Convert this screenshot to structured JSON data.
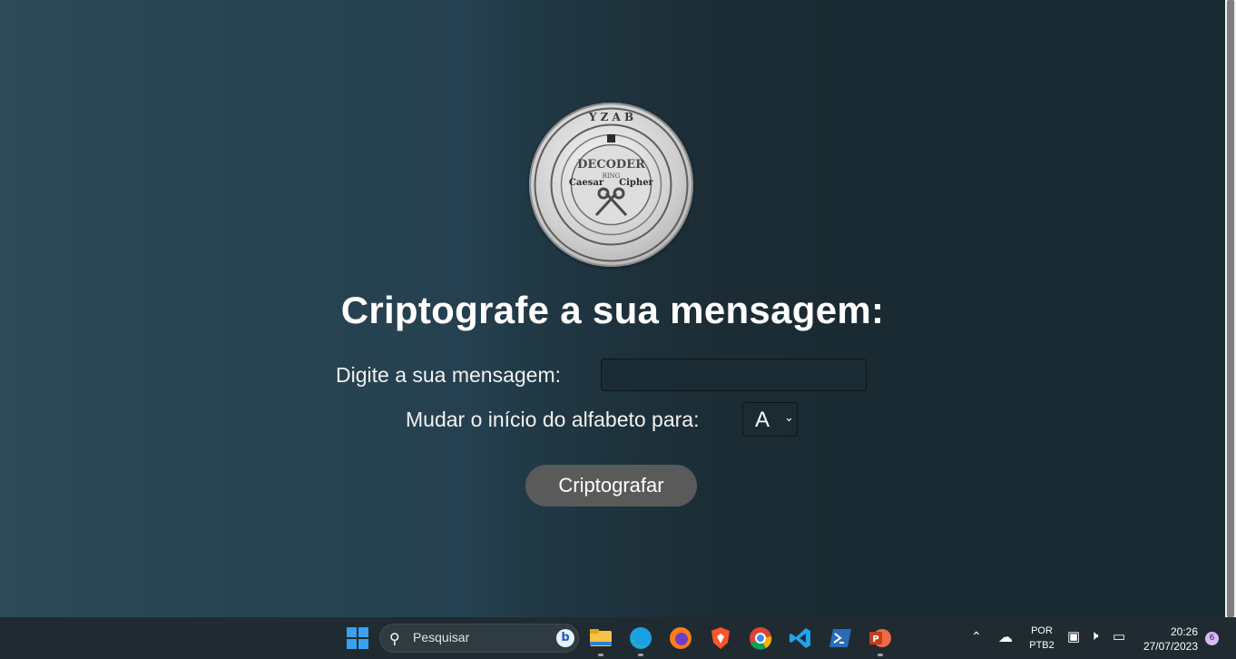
{
  "page": {
    "logo_texts": {
      "ring": "DECODER",
      "ring_sub": "RING",
      "left": "Caesar",
      "right": "Cipher"
    },
    "title": "Criptografe a sua mensagem:",
    "message_label": "Digite a sua mensagem:",
    "message_value": "",
    "shift_label": "Mudar o início do alfabeto para:",
    "shift_value": "A",
    "submit_label": "Criptografar"
  },
  "taskbar": {
    "search_placeholder": "Pesquisar",
    "bing_glyph": "b",
    "apps": [
      "start-menu",
      "search",
      "file-explorer",
      "edge",
      "firefox",
      "brave",
      "chrome",
      "vscode",
      "powershell",
      "powerpoint"
    ],
    "lang_top": "POR",
    "lang_bottom": "PTB2",
    "time": "20:26",
    "date": "27/07/2023",
    "notifications": "6"
  },
  "colors": {
    "accent_button": "#5a5a5a",
    "background_left": "#2d4b59",
    "background_right": "#1a2a32"
  }
}
